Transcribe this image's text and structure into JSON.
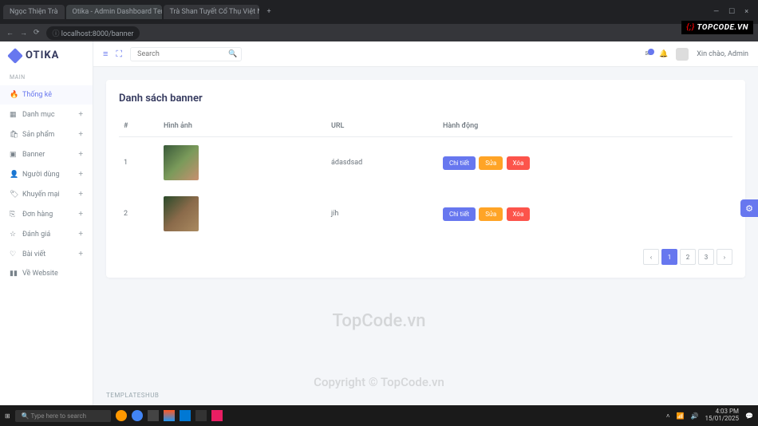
{
  "browser": {
    "tabs": [
      "Ngọc Thiện Trà",
      "Otika - Admin Dashboard Tem...",
      "Trà Shan Tuyết Cổ Thụ Việt Na..."
    ],
    "url": "localhost:8000/banner"
  },
  "logo": "OTIKA",
  "section": "MAIN",
  "nav": [
    {
      "icon": "🔥",
      "label": "Thống kê",
      "expandable": false,
      "active": true
    },
    {
      "icon": "▦",
      "label": "Danh mục",
      "expandable": true
    },
    {
      "icon": "🛍",
      "label": "Sản phẩm",
      "expandable": true
    },
    {
      "icon": "▣",
      "label": "Banner",
      "expandable": true
    },
    {
      "icon": "👤",
      "label": "Người dùng",
      "expandable": true
    },
    {
      "icon": "🏷",
      "label": "Khuyến mại",
      "expandable": true
    },
    {
      "icon": "⎘",
      "label": "Đơn hàng",
      "expandable": true
    },
    {
      "icon": "☆",
      "label": "Đánh giá",
      "expandable": true
    },
    {
      "icon": "♡",
      "label": "Bài viết",
      "expandable": true
    },
    {
      "icon": "▮▮",
      "label": "Về Website",
      "expandable": false
    }
  ],
  "search_placeholder": "Search",
  "greeting": "Xin chào, Admin",
  "card_title": "Danh sách banner",
  "columns": {
    "num": "#",
    "img": "Hình ảnh",
    "url": "URL",
    "action": "Hành động"
  },
  "rows": [
    {
      "num": "1",
      "url": "ádasdsad"
    },
    {
      "num": "2",
      "url": "jíh"
    }
  ],
  "actions": {
    "detail": "Chi tiết",
    "edit": "Sửa",
    "delete": "Xóa"
  },
  "pages": [
    "1",
    "2",
    "3"
  ],
  "footer": "TEMPLATESHUB",
  "watermarks": {
    "topcode": "TOPCODE.VN",
    "center": "TopCode.vn",
    "copy": "Copyright © TopCode.vn"
  },
  "taskbar": {
    "search": "Type here to search",
    "time": "4:03 PM",
    "date": "15/01/2025"
  }
}
